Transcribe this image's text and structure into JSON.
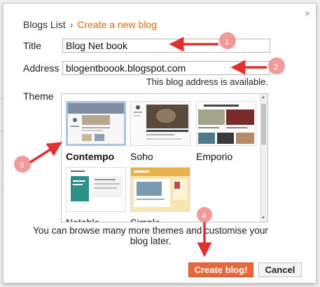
{
  "dialog": {
    "close_glyph": "×",
    "breadcrumb": {
      "parent": "Blogs List",
      "separator": "›",
      "current": "Create a new blog"
    },
    "title_label": "Title",
    "title_value": "Blog Net book",
    "address_label": "Address",
    "address_value": "blogentboook.blogspot.com",
    "availability_note": "This blog address is available.",
    "theme_label": "Theme",
    "themes": [
      {
        "name": "Contempo",
        "selected": true
      },
      {
        "name": "Soho",
        "selected": false
      },
      {
        "name": "Emporio",
        "selected": false
      },
      {
        "name": "Notable",
        "selected": false
      },
      {
        "name": "Simple",
        "selected": false
      }
    ],
    "footer_note": "You can browse many more themes and customise your blog later.",
    "create_button": "Create blog!",
    "cancel_button": "Cancel"
  },
  "annotations": {
    "color": "#e0312d",
    "badge_color": "#ef8a8a",
    "badges": [
      "1",
      "2",
      "3",
      "4"
    ]
  }
}
